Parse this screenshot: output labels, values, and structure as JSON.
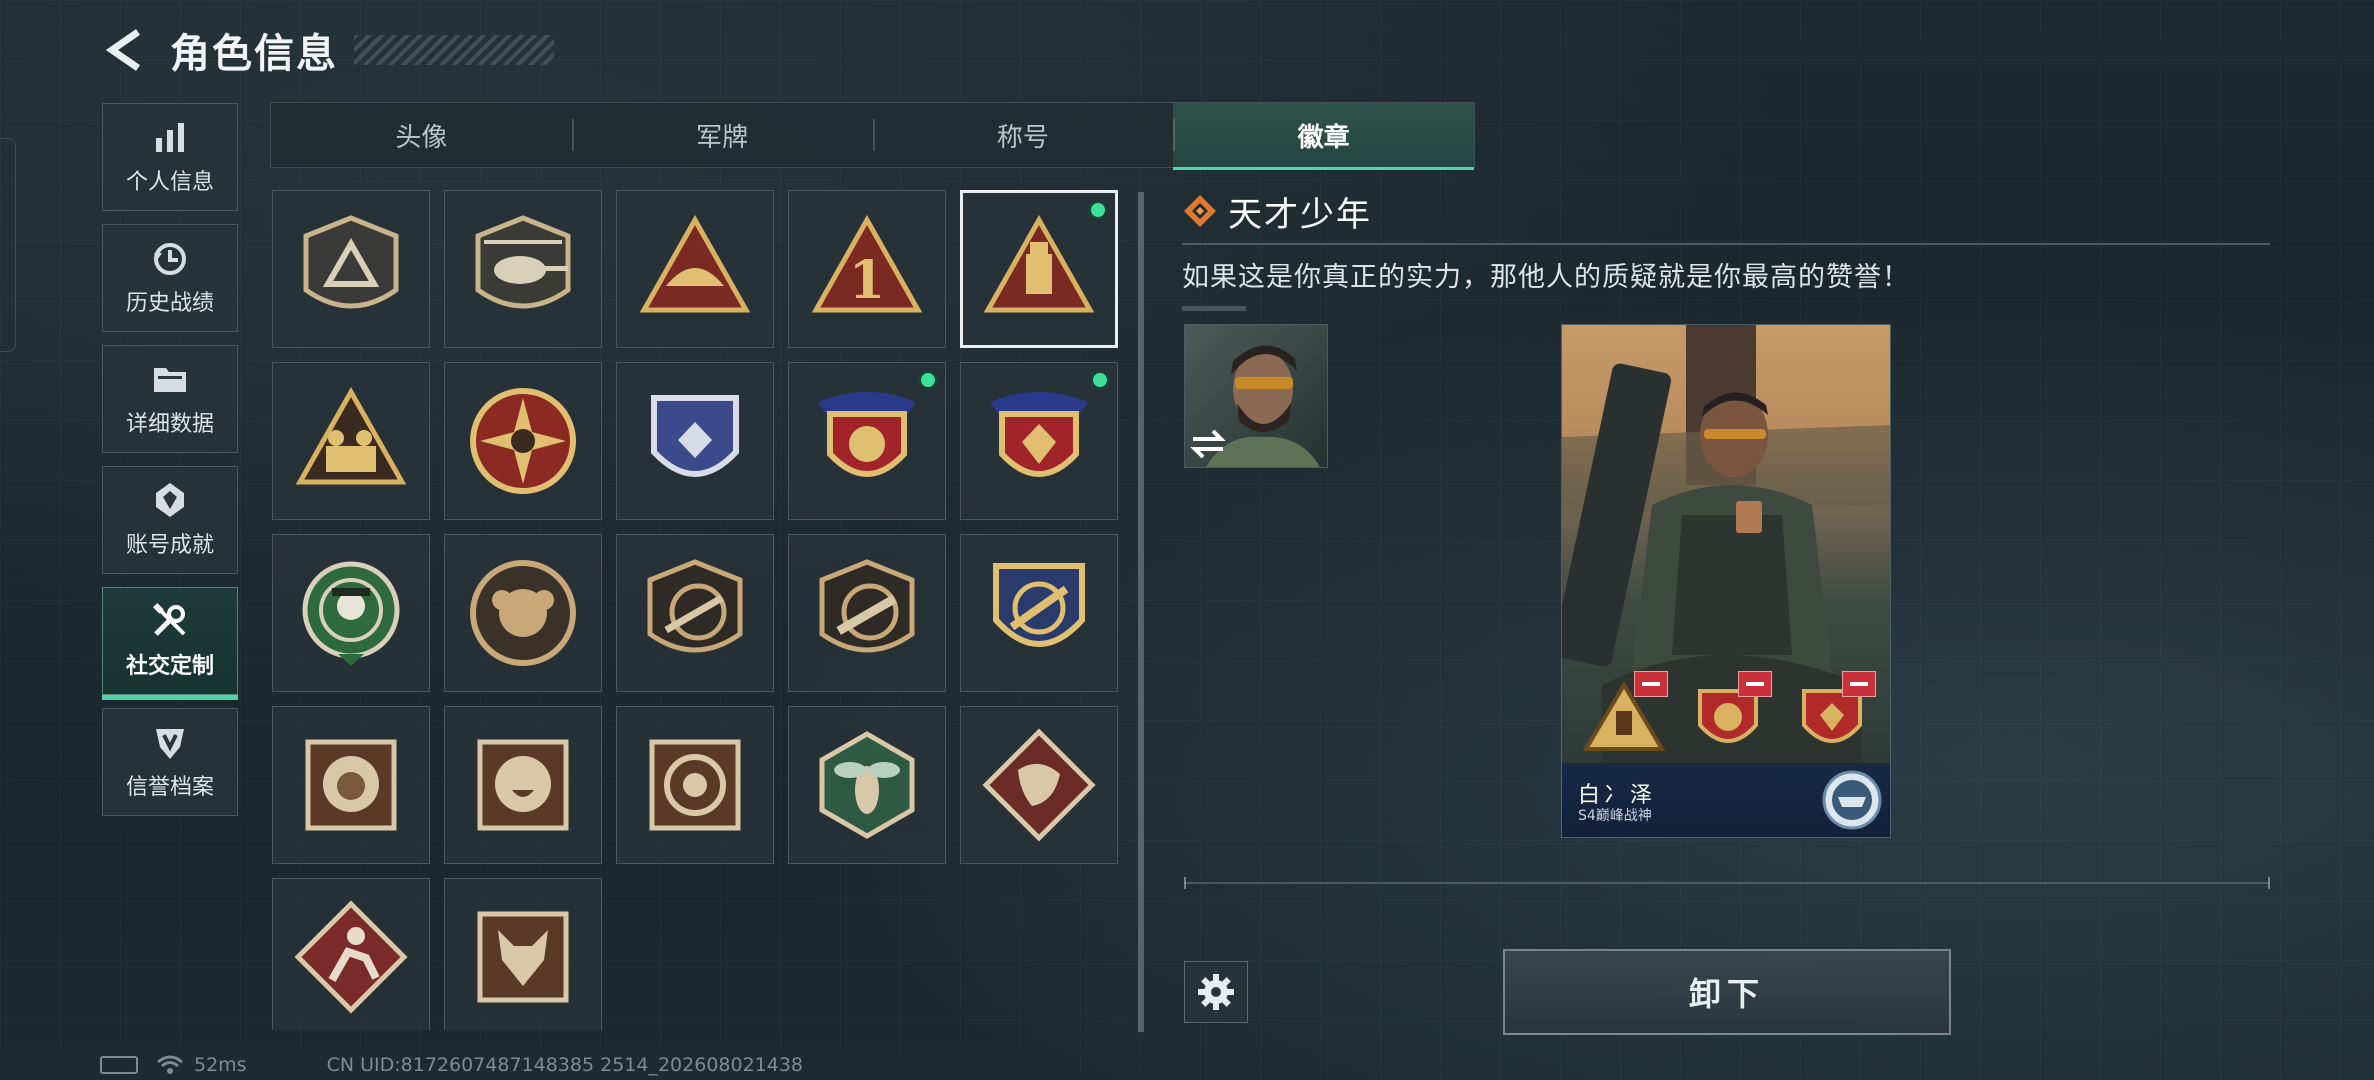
{
  "header": {
    "title": "角色信息"
  },
  "sidebar": {
    "items": [
      {
        "label": "个人信息",
        "icon": "bar-chart-icon"
      },
      {
        "label": "历史战绩",
        "icon": "history-clock-icon"
      },
      {
        "label": "详细数据",
        "icon": "folder-icon"
      },
      {
        "label": "账号成就",
        "icon": "medal-icon"
      },
      {
        "label": "社交定制",
        "icon": "tools-icon",
        "active": true
      },
      {
        "label": "信誉档案",
        "icon": "shield-v-icon"
      }
    ]
  },
  "tabs": [
    {
      "label": "头像"
    },
    {
      "label": "军牌"
    },
    {
      "label": "称号"
    },
    {
      "label": "徽章",
      "active": true
    }
  ],
  "badges": [
    {
      "name": "triangle-shield-badge",
      "equipped": false
    },
    {
      "name": "helicopter-badge",
      "equipped": false
    },
    {
      "name": "hand-triangle-badge",
      "equipped": false
    },
    {
      "name": "number-one-badge",
      "equipped": false
    },
    {
      "name": "usb-triangle-badge",
      "equipped": true,
      "selected": true
    },
    {
      "name": "soldiers-triangle-badge",
      "equipped": false
    },
    {
      "name": "star-compass-badge",
      "equipped": false
    },
    {
      "name": "blue-shield-badge",
      "equipped": false
    },
    {
      "name": "red-crest-badge",
      "equipped": true
    },
    {
      "name": "red-crest-gem-badge",
      "equipped": true
    },
    {
      "name": "skull-target-badge",
      "equipped": false
    },
    {
      "name": "bronze-round-badge",
      "equipped": false
    },
    {
      "name": "rifle-shield-badge",
      "equipped": false
    },
    {
      "name": "rifle-shield-2-badge",
      "equipped": false
    },
    {
      "name": "crossed-scope-badge",
      "equipped": false
    },
    {
      "name": "lion-badge",
      "equipped": false
    },
    {
      "name": "lion-roar-badge",
      "equipped": false
    },
    {
      "name": "target-ring-badge",
      "equipped": false
    },
    {
      "name": "wasp-badge",
      "equipped": false
    },
    {
      "name": "dragon-badge",
      "equipped": false
    },
    {
      "name": "runner-badge",
      "equipped": false
    },
    {
      "name": "fox-badge",
      "equipped": false
    }
  ],
  "detail": {
    "badge_name": "天才少年",
    "description": "如果这是你真正的实力，那他人的质疑就是你最高的赞誉！",
    "player_name": "白冫泽",
    "player_title": "S4巅峰战神",
    "unequip_label": "卸下"
  },
  "status": {
    "ping": "52ms",
    "uid": "CN UID:8172607487148385 2514_202608021438"
  },
  "colors": {
    "accent": "#4fd6a6",
    "equipped_dot": "#3de09a",
    "remove_red": "#c8313a"
  }
}
